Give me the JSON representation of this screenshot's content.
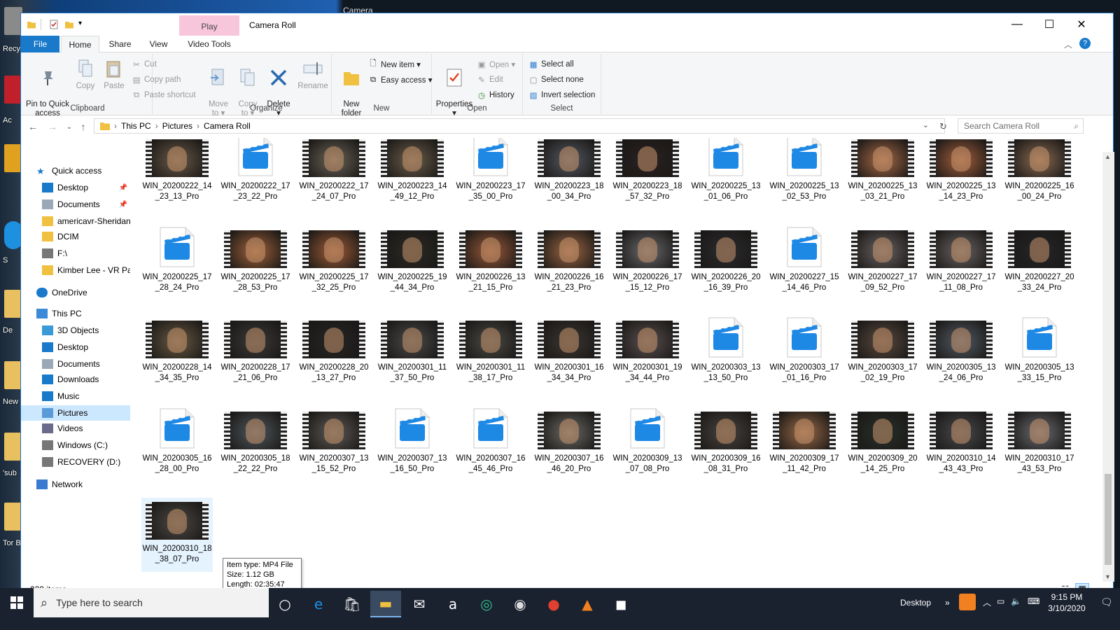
{
  "desktop": {
    "labels": [
      "Recy",
      "Ac\nRea",
      "S",
      "De\nSho",
      "New",
      "'sub\nfo",
      "Tor B"
    ],
    "background_window_title": "Camera"
  },
  "window": {
    "title": "Camera Roll",
    "context_tab": "Play",
    "controls": {
      "minimize": "—",
      "maximize": "☐",
      "close": "✕"
    }
  },
  "ribbon_tabs": [
    "File",
    "Home",
    "Share",
    "View",
    "Video Tools"
  ],
  "ribbon": {
    "clipboard": {
      "label": "Clipboard",
      "pin": "Pin to Quick\naccess",
      "copy": "Copy",
      "paste": "Paste",
      "cut": "Cut",
      "copy_path": "Copy path",
      "paste_shortcut": "Paste shortcut"
    },
    "organize": {
      "label": "Organize",
      "move_to": "Move\nto ▾",
      "copy_to": "Copy\nto ▾",
      "delete": "Delete\n▾",
      "rename": "Rename"
    },
    "new": {
      "label": "New",
      "new_folder": "New\nfolder",
      "new_item": "New item ▾",
      "easy_access": "Easy access ▾"
    },
    "open": {
      "label": "Open",
      "properties": "Properties\n▾",
      "open": "Open ▾",
      "edit": "Edit",
      "history": "History"
    },
    "select": {
      "label": "Select",
      "select_all": "Select all",
      "select_none": "Select none",
      "invert": "Invert selection"
    }
  },
  "address": {
    "path": [
      "This PC",
      "Pictures",
      "Camera Roll"
    ],
    "search_placeholder": "Search Camera Roll"
  },
  "navpane": {
    "items": [
      {
        "label": "Quick access",
        "icon": "star-icon",
        "pinned": false
      },
      {
        "label": "Desktop",
        "icon": "desktop-icon",
        "pinned": true
      },
      {
        "label": "Documents",
        "icon": "document-icon",
        "pinned": true
      },
      {
        "label": "americavr-Sheridan.",
        "icon": "folder-icon",
        "pinned": false
      },
      {
        "label": "DCIM",
        "icon": "folder-icon",
        "pinned": false
      },
      {
        "label": "F:\\",
        "icon": "drive-icon",
        "pinned": false
      },
      {
        "label": "Kimber Lee - VR Pac",
        "icon": "folder-icon",
        "pinned": false
      },
      {
        "label": "OneDrive",
        "icon": "cloud-icon",
        "pinned": false
      },
      {
        "label": "This PC",
        "icon": "computer-icon",
        "pinned": false
      },
      {
        "label": "3D Objects",
        "icon": "cube-icon",
        "pinned": false
      },
      {
        "label": "Desktop",
        "icon": "desktop-icon",
        "pinned": false
      },
      {
        "label": "Documents",
        "icon": "document-icon",
        "pinned": false
      },
      {
        "label": "Downloads",
        "icon": "download-icon",
        "pinned": false
      },
      {
        "label": "Music",
        "icon": "music-icon",
        "pinned": false
      },
      {
        "label": "Pictures",
        "icon": "picture-icon",
        "pinned": false,
        "selected": true
      },
      {
        "label": "Videos",
        "icon": "video-icon",
        "pinned": false
      },
      {
        "label": "Windows (C:)",
        "icon": "drive-icon",
        "pinned": false
      },
      {
        "label": "RECOVERY (D:)",
        "icon": "drive-icon",
        "pinned": false
      },
      {
        "label": "Network",
        "icon": "network-icon",
        "pinned": false
      }
    ]
  },
  "files": [
    {
      "name": "WIN_20200222_14_23_13_Pro",
      "thumb": "video",
      "tone": "#6a5a48"
    },
    {
      "name": "WIN_20200222_17_23_22_Pro",
      "thumb": "clip",
      "tone": ""
    },
    {
      "name": "WIN_20200222_17_24_07_Pro",
      "thumb": "video",
      "tone": "#6b6458"
    },
    {
      "name": "WIN_20200223_14_49_12_Pro",
      "thumb": "video",
      "tone": "#6d5f4c"
    },
    {
      "name": "WIN_20200223_17_35_00_Pro",
      "thumb": "clip",
      "tone": ""
    },
    {
      "name": "WIN_20200223_18_00_34_Pro",
      "thumb": "video",
      "tone": "#555a62"
    },
    {
      "name": "WIN_20200223_18_57_32_Pro",
      "thumb": "video",
      "tone": "#2a2222"
    },
    {
      "name": "WIN_20200225_13_01_06_Pro",
      "thumb": "clip",
      "tone": ""
    },
    {
      "name": "WIN_20200225_13_02_53_Pro",
      "thumb": "clip",
      "tone": ""
    },
    {
      "name": "WIN_20200225_13_03_21_Pro",
      "thumb": "video",
      "tone": "#a86a48"
    },
    {
      "name": "WIN_20200225_13_14_23_Pro",
      "thumb": "video",
      "tone": "#a4603e"
    },
    {
      "name": "WIN_20200225_16_00_24_Pro",
      "thumb": "video",
      "tone": "#8a6a52"
    },
    {
      "name": "WIN_20200225_17_28_24_Pro",
      "thumb": "clip",
      "tone": ""
    },
    {
      "name": "WIN_20200225_17_28_53_Pro",
      "thumb": "video",
      "tone": "#a0623c"
    },
    {
      "name": "WIN_20200225_17_32_25_Pro",
      "thumb": "video",
      "tone": "#9e5c38"
    },
    {
      "name": "WIN_20200225_19_44_34_Pro",
      "thumb": "video",
      "tone": "#2a2a26"
    },
    {
      "name": "WIN_20200226_13_21_15_Pro",
      "thumb": "video",
      "tone": "#9a5a3a"
    },
    {
      "name": "WIN_20200226_16_21_23_Pro",
      "thumb": "video",
      "tone": "#9c6644"
    },
    {
      "name": "WIN_20200226_17_15_12_Pro",
      "thumb": "video",
      "tone": "#6a6a6e"
    },
    {
      "name": "WIN_20200226_20_16_39_Pro",
      "thumb": "video",
      "tone": "#2c2c30"
    },
    {
      "name": "WIN_20200227_15_14_46_Pro",
      "thumb": "clip",
      "tone": ""
    },
    {
      "name": "WIN_20200227_17_09_52_Pro",
      "thumb": "video",
      "tone": "#6a6464"
    },
    {
      "name": "WIN_20200227_17_11_08_Pro",
      "thumb": "video",
      "tone": "#6c6666"
    },
    {
      "name": "WIN_20200227_20_33_24_Pro",
      "thumb": "video",
      "tone": "#26262a"
    },
    {
      "name": "WIN_20200228_14_34_35_Pro",
      "thumb": "video",
      "tone": "#6a5a44"
    },
    {
      "name": "WIN_20200228_17_21_06_Pro",
      "thumb": "video",
      "tone": "#3c3a38"
    },
    {
      "name": "WIN_20200228_20_13_27_Pro",
      "thumb": "video",
      "tone": "#262626"
    },
    {
      "name": "WIN_20200301_11_37_50_Pro",
      "thumb": "video",
      "tone": "#4a4a48"
    },
    {
      "name": "WIN_20200301_11_38_17_Pro",
      "thumb": "video",
      "tone": "#4c4a46"
    },
    {
      "name": "WIN_20200301_16_34_34_Pro",
      "thumb": "video",
      "tone": "#3a3632"
    },
    {
      "name": "WIN_20200301_19_34_44_Pro",
      "thumb": "video",
      "tone": "#5a5050"
    },
    {
      "name": "WIN_20200303_13_13_50_Pro",
      "thumb": "clip",
      "tone": ""
    },
    {
      "name": "WIN_20200303_17_01_16_Pro",
      "thumb": "clip",
      "tone": ""
    },
    {
      "name": "WIN_20200303_17_02_19_Pro",
      "thumb": "video",
      "tone": "#5a4a40"
    },
    {
      "name": "WIN_20200305_13_24_06_Pro",
      "thumb": "video",
      "tone": "#545c66"
    },
    {
      "name": "WIN_20200305_13_33_15_Pro",
      "thumb": "clip",
      "tone": ""
    },
    {
      "name": "WIN_20200305_16_28_00_Pro",
      "thumb": "clip",
      "tone": ""
    },
    {
      "name": "WIN_20200305_18_22_22_Pro",
      "thumb": "video",
      "tone": "#50585e"
    },
    {
      "name": "WIN_20200307_13_15_52_Pro",
      "thumb": "video",
      "tone": "#5e5a56"
    },
    {
      "name": "WIN_20200307_13_16_50_Pro",
      "thumb": "clip",
      "tone": ""
    },
    {
      "name": "WIN_20200307_16_45_46_Pro",
      "thumb": "clip",
      "tone": ""
    },
    {
      "name": "WIN_20200307_16_46_20_Pro",
      "thumb": "video",
      "tone": "#6a6a66"
    },
    {
      "name": "WIN_20200309_13_07_08_Pro",
      "thumb": "clip",
      "tone": ""
    },
    {
      "name": "WIN_20200309_16_08_31_Pro",
      "thumb": "video",
      "tone": "#4a4440"
    },
    {
      "name": "WIN_20200309_17_11_42_Pro",
      "thumb": "video",
      "tone": "#9a6a48"
    },
    {
      "name": "WIN_20200309_20_14_25_Pro",
      "thumb": "video",
      "tone": "#28302a"
    },
    {
      "name": "WIN_20200310_14_43_43_Pro",
      "thumb": "video",
      "tone": "#4a4a4e"
    },
    {
      "name": "WIN_20200310_17_43_53_Pro",
      "thumb": "video",
      "tone": "#6a6a70"
    },
    {
      "name": "WIN_20200310_18_38_07_Pro",
      "thumb": "video",
      "tone": "#4c4844",
      "selected": true
    }
  ],
  "tooltip": {
    "type": "Item type: MP4 File",
    "size": "Size: 1.12 GB",
    "length": "Length: 02:35:47"
  },
  "status": {
    "count": "229 items"
  },
  "taskbar": {
    "search_placeholder": "Type here to search",
    "desktop_label": "Desktop",
    "time": "9:15 PM",
    "date": "3/10/2020",
    "apps": [
      "task-view-icon",
      "edge-icon",
      "store-icon",
      "file-explorer-icon",
      "mail-icon",
      "amazon-icon",
      "tripadvisor-icon",
      "camera-app-icon",
      "chrome-icon",
      "vlc-icon",
      "camera-icon"
    ]
  },
  "colors": {
    "accent": "#1979ca",
    "context_tab": "#f7c6da",
    "selection": "#cce8ff",
    "clip_blue": "#1e88e5"
  }
}
